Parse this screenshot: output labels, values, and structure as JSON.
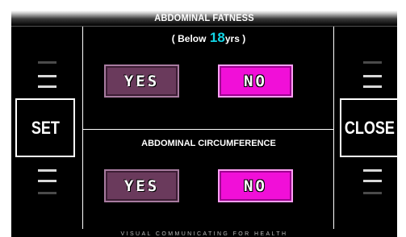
{
  "header": {
    "title": "ABDOMINAL FATNESS"
  },
  "question1": {
    "prefix": "( Below",
    "age": "18",
    "suffix": "yrs )",
    "yes_label": "YES",
    "no_label": "NO",
    "selected": "NO"
  },
  "question2": {
    "title": "ABDOMINAL CIRCUMFERENCE",
    "yes_label": "YES",
    "no_label": "NO",
    "selected": "NO"
  },
  "side": {
    "set_label": "SET",
    "close_label": "CLOSE"
  },
  "footer": {
    "text": "VISUAL COMMUNICATING FOR HEALTH"
  },
  "colors": {
    "accent_selected": "#f10fd8",
    "option_unselected": "#6a3a5c",
    "age_highlight": "#12d6e6",
    "background": "#000000"
  }
}
